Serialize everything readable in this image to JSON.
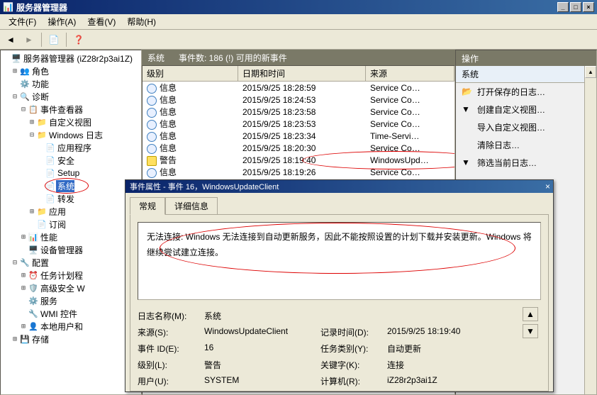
{
  "window": {
    "title": "服务器管理器"
  },
  "menu": {
    "file": "文件(F)",
    "action": "操作(A)",
    "view": "查看(V)",
    "help": "帮助(H)"
  },
  "tree": {
    "root": "服务器管理器 (iZ28r2p3ai1Z)",
    "roles": "角色",
    "features": "功能",
    "diagnostics": "诊断",
    "event_viewer": "事件查看器",
    "custom_views": "自定义视图",
    "windows_logs": "Windows 日志",
    "application": "应用程序",
    "security": "安全",
    "setup": "Setup",
    "system": "系统",
    "forwarded": "转发",
    "app_services": "应用",
    "subscriptions": "订阅",
    "performance": "性能",
    "device_manager": "设备管理器",
    "configuration": "配置",
    "task_scheduler": "任务计划程",
    "advanced_security": "高级安全 W",
    "services": "服务",
    "wmi": "WMI 控件",
    "local_users": "本地用户和",
    "storage": "存储"
  },
  "center": {
    "heading": "系统",
    "count_label": "事件数: 186 (!) 可用的新事件",
    "columns": {
      "level": "级别",
      "datetime": "日期和时间",
      "source": "来源"
    },
    "rows": [
      {
        "type": "info",
        "level": "信息",
        "dt": "2015/9/25 18:28:59",
        "src": "Service Co…"
      },
      {
        "type": "info",
        "level": "信息",
        "dt": "2015/9/25 18:24:53",
        "src": "Service Co…"
      },
      {
        "type": "info",
        "level": "信息",
        "dt": "2015/9/25 18:23:58",
        "src": "Service Co…"
      },
      {
        "type": "info",
        "level": "信息",
        "dt": "2015/9/25 18:23:53",
        "src": "Service Co…"
      },
      {
        "type": "info",
        "level": "信息",
        "dt": "2015/9/25 18:23:34",
        "src": "Time-Servi…"
      },
      {
        "type": "info",
        "level": "信息",
        "dt": "2015/9/25 18:20:30",
        "src": "Service Co…"
      },
      {
        "type": "warn",
        "level": "警告",
        "dt": "2015/9/25 18:19:40",
        "src": "WindowsUpd…",
        "circled": true
      },
      {
        "type": "info",
        "level": "信息",
        "dt": "2015/9/25 18:19:26",
        "src": "Service Co…"
      }
    ]
  },
  "actions": {
    "heading": "操作",
    "subheading": "系统",
    "items": [
      {
        "icon": "📂",
        "label": "打开保存的日志…"
      },
      {
        "icon": "▼",
        "label": "创建自定义视图…"
      },
      {
        "icon": "",
        "label": "导入自定义视图…"
      },
      {
        "icon": "",
        "label": "清除日志…"
      },
      {
        "icon": "▼",
        "label": "筛选当前日志…"
      }
    ]
  },
  "dialog": {
    "title": "事件属性 - 事件 16，WindowsUpdateClient",
    "tabs": {
      "general": "常规",
      "details": "详细信息"
    },
    "message": "无法连接: Windows 无法连接到自动更新服务，因此不能按照设置的计划下载并安装更新。Windows 将继续尝试建立连接。",
    "fields": {
      "log_name_l": "日志名称(M):",
      "log_name_v": "系统",
      "source_l": "来源(S):",
      "source_v": "WindowsUpdateClient",
      "logged_l": "记录时间(D):",
      "logged_v": "2015/9/25 18:19:40",
      "event_id_l": "事件 ID(E):",
      "event_id_v": "16",
      "task_cat_l": "任务类别(Y):",
      "task_cat_v": "自动更新",
      "level_l": "级别(L):",
      "level_v": "警告",
      "keywords_l": "关键字(K):",
      "keywords_v": "连接",
      "user_l": "用户(U):",
      "user_v": "SYSTEM",
      "computer_l": "计算机(R):",
      "computer_v": "iZ28r2p3ai1Z"
    }
  }
}
